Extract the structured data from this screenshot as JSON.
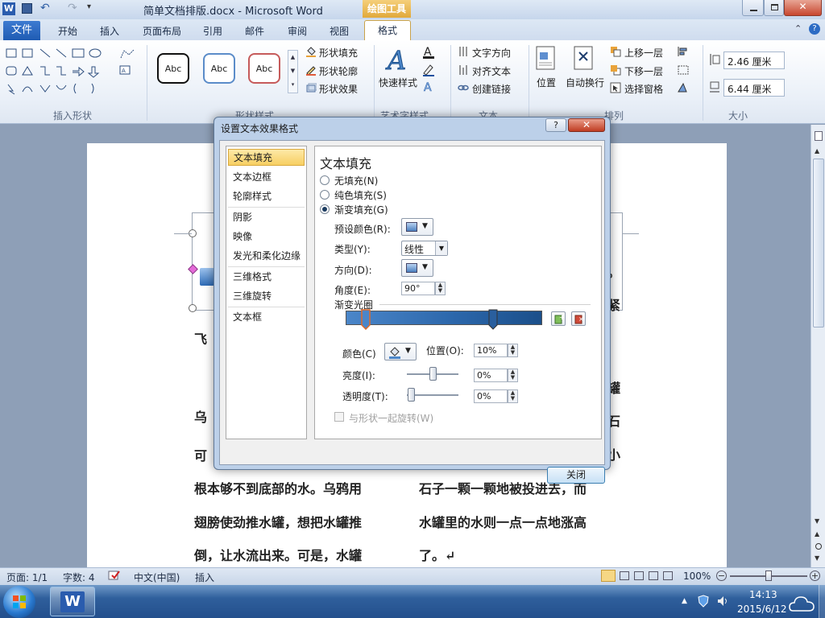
{
  "window": {
    "title": "简单文档排版.docx - Microsoft Word",
    "contextual_tab": "绘图工具"
  },
  "ribbon": {
    "file_tab": "文件",
    "tabs": [
      "开始",
      "插入",
      "页面布局",
      "引用",
      "邮件",
      "审阅",
      "视图"
    ],
    "active_tab": "格式",
    "groups": {
      "insert_shapes": "插入形状",
      "shape_styles": "形状样式",
      "art_styles": "艺术字样式",
      "text": "文本",
      "arrange": "排列",
      "size": "大小"
    },
    "style_samples": [
      "Abc",
      "Abc",
      "Abc"
    ],
    "shape_fill": "形状填充",
    "shape_outline": "形状轮廓",
    "shape_effects": "形状效果",
    "quick_styles": "快速样式",
    "text_direction": "文字方向",
    "align_text": "对齐文本",
    "create_link": "创建链接",
    "position": "位置",
    "wrap_text": "自动换行",
    "bring_forward": "上移一层",
    "send_backward": "下移一层",
    "selection_pane": "选择窗格",
    "height_value": "2.46 厘米",
    "width_value": "6.44 厘米"
  },
  "dialog": {
    "title": "设置文本效果格式",
    "help": "?",
    "close_x": "✕",
    "nav": [
      "文本填充",
      "文本边框",
      "轮廓样式",
      "阴影",
      "映像",
      "发光和柔化边缘",
      "三维格式",
      "三维旋转",
      "文本框"
    ],
    "selected_nav": "文本填充",
    "panel_title": "文本填充",
    "fill_options": [
      "无填充(N)",
      "纯色填充(S)",
      "渐变填充(G)"
    ],
    "selected_fill": "渐变填充(G)",
    "preset_label": "预设颜色(R):",
    "type_label": "类型(Y):",
    "type_value": "线性",
    "direction_label": "方向(D):",
    "angle_label": "角度(E):",
    "angle_value": "90°",
    "gradient_stops_label": "渐变光圈",
    "color_label": "颜色(C)",
    "position_label": "位置(O):",
    "position_value": "10%",
    "brightness_label": "亮度(I):",
    "brightness_value": "0%",
    "transparency_label": "透明度(T):",
    "transparency_value": "0%",
    "rotate_with_shape": "与形状一起旋转(W)",
    "close_button": "关闭"
  },
  "document": {
    "left_lines": [
      "飞",
      "乌",
      "可",
      "根本够不到底部的水。乌鸦用",
      "翅膀使劲推水罐，想把水罐推",
      "倒，让水流出来。可是，水罐"
    ],
    "right_lines": [
      "。",
      "紧",
      "罐",
      "石",
      "小",
      "石子一颗一颗地被投进去，而",
      "水罐里的水则一点一点地涨高",
      "了。↵"
    ]
  },
  "status": {
    "page": "页面: 1/1",
    "words": "字数: 4",
    "language": "中文(中国)",
    "mode": "插入",
    "zoom": "100%"
  },
  "taskbar": {
    "time": "14:13",
    "date": "2015/6/12"
  },
  "colors": {
    "file_tab": "#1f5bb3",
    "gradient_start": "#4b86c9",
    "gradient_end": "#1b4f8a",
    "nav_selected": "#f7cf62"
  }
}
